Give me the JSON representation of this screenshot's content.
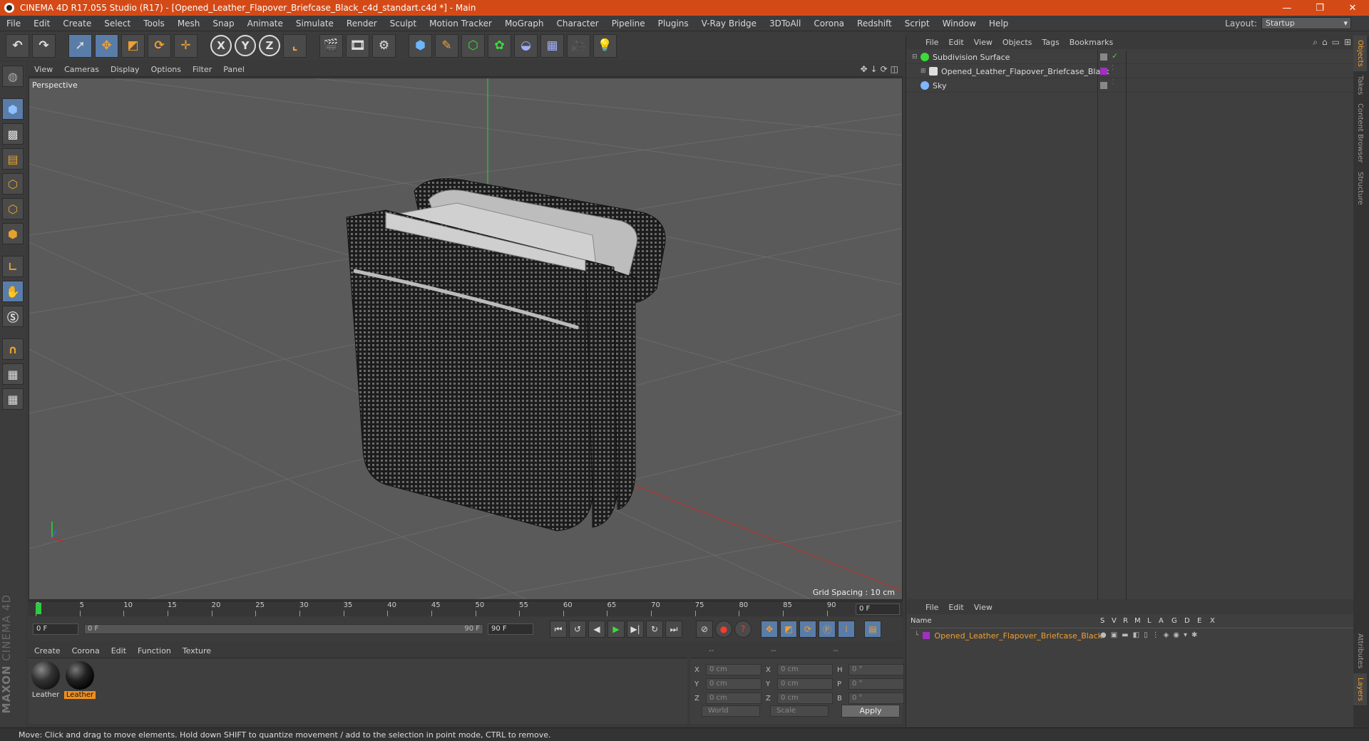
{
  "window": {
    "title": "CINEMA 4D R17.055 Studio (R17) - [Opened_Leather_Flapover_Briefcase_Black_c4d_standart.c4d *] - Main",
    "minimize": "—",
    "maximize": "❐",
    "close": "✕"
  },
  "menu": [
    "File",
    "Edit",
    "Create",
    "Select",
    "Tools",
    "Mesh",
    "Snap",
    "Animate",
    "Simulate",
    "Render",
    "Sculpt",
    "Motion Tracker",
    "MoGraph",
    "Character",
    "Pipeline",
    "Plugins",
    "V-Ray Bridge",
    "3DToAll",
    "Corona",
    "Redshift",
    "Script",
    "Window",
    "Help"
  ],
  "layout": {
    "label": "Layout:",
    "value": "Startup"
  },
  "toolbar": {
    "x": "X",
    "y": "Y",
    "z": "Z"
  },
  "viewport": {
    "menu": [
      "View",
      "Cameras",
      "Display",
      "Options",
      "Filter",
      "Panel"
    ],
    "label": "Perspective",
    "grid_spacing": "Grid Spacing : 10 cm"
  },
  "timeline": {
    "ticks": [
      "0",
      "5",
      "10",
      "15",
      "20",
      "25",
      "30",
      "35",
      "40",
      "45",
      "50",
      "55",
      "60",
      "65",
      "70",
      "75",
      "80",
      "85",
      "90"
    ],
    "current_frame": "0 F"
  },
  "transport": {
    "start": "0 F",
    "slider_start": "0 F",
    "slider_end": "90 F",
    "end": "90 F"
  },
  "materials": {
    "menu": [
      "Create",
      "Corona",
      "Edit",
      "Function",
      "Texture"
    ],
    "items": [
      {
        "label": "Leather"
      },
      {
        "label": "Leather"
      }
    ]
  },
  "coordinates": {
    "header": [
      "--",
      "--",
      "--"
    ],
    "rows": [
      {
        "a": "X",
        "av": "0 cm",
        "b": "X",
        "bv": "0 cm",
        "c": "H",
        "cv": "0 °"
      },
      {
        "a": "Y",
        "av": "0 cm",
        "b": "Y",
        "bv": "0 cm",
        "c": "P",
        "cv": "0 °"
      },
      {
        "a": "Z",
        "av": "0 cm",
        "b": "Z",
        "bv": "0 cm",
        "c": "B",
        "cv": "0 °"
      }
    ],
    "space": "World",
    "mode": "Scale",
    "apply": "Apply"
  },
  "status": "Move: Click and drag to move elements. Hold down SHIFT to quantize movement / add to the selection in point mode, CTRL to remove.",
  "objects": {
    "menu": [
      "File",
      "Edit",
      "View",
      "Objects",
      "Tags",
      "Bookmarks"
    ],
    "items": [
      {
        "name": "Subdivision Surface"
      },
      {
        "name": "Opened_Leather_Flapover_Briefcase_Black"
      },
      {
        "name": "Sky"
      }
    ]
  },
  "side_tabs": [
    "Objects",
    "Takes",
    "Content Browser",
    "Structure"
  ],
  "side_tabs_bottom": [
    "Attributes",
    "Layers"
  ],
  "layers": {
    "menu": [
      "File",
      "Edit",
      "View"
    ],
    "columns": [
      "Name",
      "S",
      "V",
      "R",
      "M",
      "L",
      "A",
      "G",
      "D",
      "E",
      "X"
    ],
    "row": "Opened_Leather_Flapover_Briefcase_Black"
  },
  "brand": {
    "maxon": "MAXON",
    "c4d": "CINEMA 4D"
  },
  "colors": {
    "title_bar": "#d44a17",
    "accent": "#f0a030",
    "selection": "#5a7da8"
  }
}
